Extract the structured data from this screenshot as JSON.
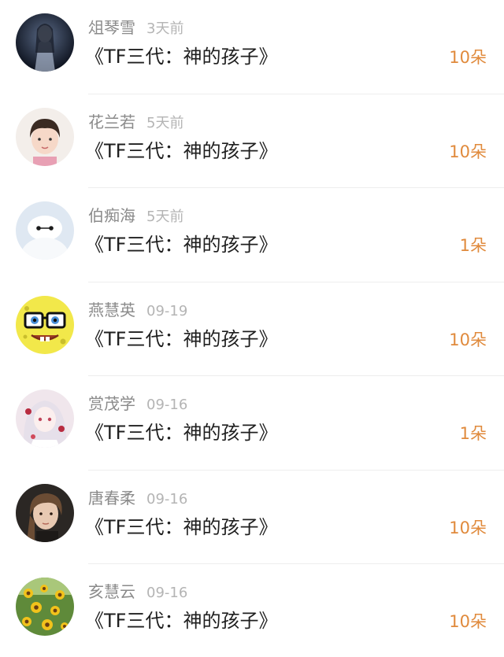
{
  "accent_color": "#e08a3c",
  "items": [
    {
      "name": "俎琴雪",
      "time": "3天前",
      "title": "《TF三代：神的孩子》",
      "count": "10朵",
      "avatar": "dark-figure-avatar"
    },
    {
      "name": "花兰若",
      "time": "5天前",
      "title": "《TF三代：神的孩子》",
      "count": "10朵",
      "avatar": "child-photo-avatar"
    },
    {
      "name": "伯痴海",
      "time": "5天前",
      "title": "《TF三代：神的孩子》",
      "count": "1朵",
      "avatar": "white-robot-avatar"
    },
    {
      "name": "燕慧英",
      "time": "09-19",
      "title": "《TF三代：神的孩子》",
      "count": "10朵",
      "avatar": "sponge-cartoon-avatar"
    },
    {
      "name": "赏茂学",
      "time": "09-16",
      "title": "《TF三代：神的孩子》",
      "count": "1朵",
      "avatar": "anime-girl-avatar"
    },
    {
      "name": "唐春柔",
      "time": "09-16",
      "title": "《TF三代：神的孩子》",
      "count": "10朵",
      "avatar": "selfie-photo-avatar"
    },
    {
      "name": "亥慧云",
      "time": "09-16",
      "title": "《TF三代：神的孩子》",
      "count": "10朵",
      "avatar": "sunflower-avatar"
    }
  ]
}
